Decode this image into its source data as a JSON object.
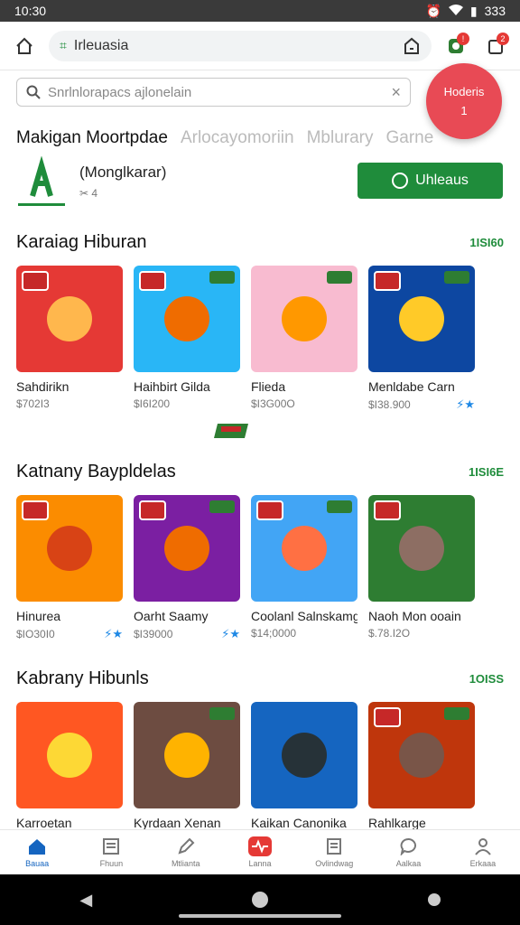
{
  "status": {
    "time": "10:30",
    "battery": "333"
  },
  "browser": {
    "url": "Irleuasia"
  },
  "search": {
    "placeholder": "Snrlnlorapacs ajlonelain"
  },
  "fab": {
    "label": "Hoderis",
    "icon_text": "1"
  },
  "tabs": [
    "Makigan Moortpdae",
    "Arlocayomoriin",
    "Mblurary",
    "Garne"
  ],
  "app": {
    "name": "(Monglkarar)",
    "sub": "✂ 4",
    "install_label": "Uhleaus"
  },
  "sections": [
    {
      "title": "Karaiag Hiburan",
      "more": "1ISI60",
      "cards": [
        {
          "name": "Sahdirikn",
          "price": "$702I3",
          "bg": "#e53935",
          "face": "#ffb74d"
        },
        {
          "name": "Haihbirt Gilda",
          "price": "$I6I200",
          "bg": "#29b6f6",
          "face": "#ef6c00"
        },
        {
          "name": "Flieda",
          "price": "$I3G00O",
          "bg": "#f8bbd0",
          "face": "#ff9800"
        },
        {
          "name": "Menldabe Carn",
          "price": "$I38.900",
          "bg": "#0d47a1",
          "face": "#ffca28"
        }
      ]
    },
    {
      "title": "Katnany Baypldelas",
      "more": "1ISI6E",
      "cards": [
        {
          "name": "Hinurea",
          "price": "$IO30I0",
          "bg": "#fb8c00",
          "face": "#d84315"
        },
        {
          "name": "Oarht Saamy",
          "price": "$I39000",
          "bg": "#7b1fa2",
          "face": "#ef6c00"
        },
        {
          "name": "Coolanl Salnskamg",
          "price": "$14;0000",
          "bg": "#42a5f5",
          "face": "#ff7043"
        },
        {
          "name": "Naoh Mon ooain",
          "price": "$.78.I2O",
          "bg": "#2e7d32",
          "face": "#8d6e63"
        }
      ]
    },
    {
      "title": "Kabrany Hibunls",
      "more": "1OISS",
      "cards": [
        {
          "name": "Karroetan",
          "price": "",
          "bg": "#ff5722",
          "face": "#fdd835"
        },
        {
          "name": "Kyrdaan Xenan",
          "price": "",
          "bg": "#6d4c41",
          "face": "#ffb300"
        },
        {
          "name": "Kaikan Canonika",
          "price": "",
          "bg": "#1565c0",
          "face": "#263238"
        },
        {
          "name": "Rahlkarge",
          "price": "",
          "bg": "#bf360c",
          "face": "#795548"
        }
      ]
    }
  ],
  "nav": [
    {
      "label": "Bauaa"
    },
    {
      "label": "Fhuun"
    },
    {
      "label": "Mtlianta"
    },
    {
      "label": "Lanna"
    },
    {
      "label": "Ovlindwag"
    },
    {
      "label": "Aalkaa"
    },
    {
      "label": "Erkaaa"
    }
  ],
  "colors": {
    "accent": "#1f8c3b",
    "fab": "#e84a55",
    "active_nav": "#1565c0"
  }
}
